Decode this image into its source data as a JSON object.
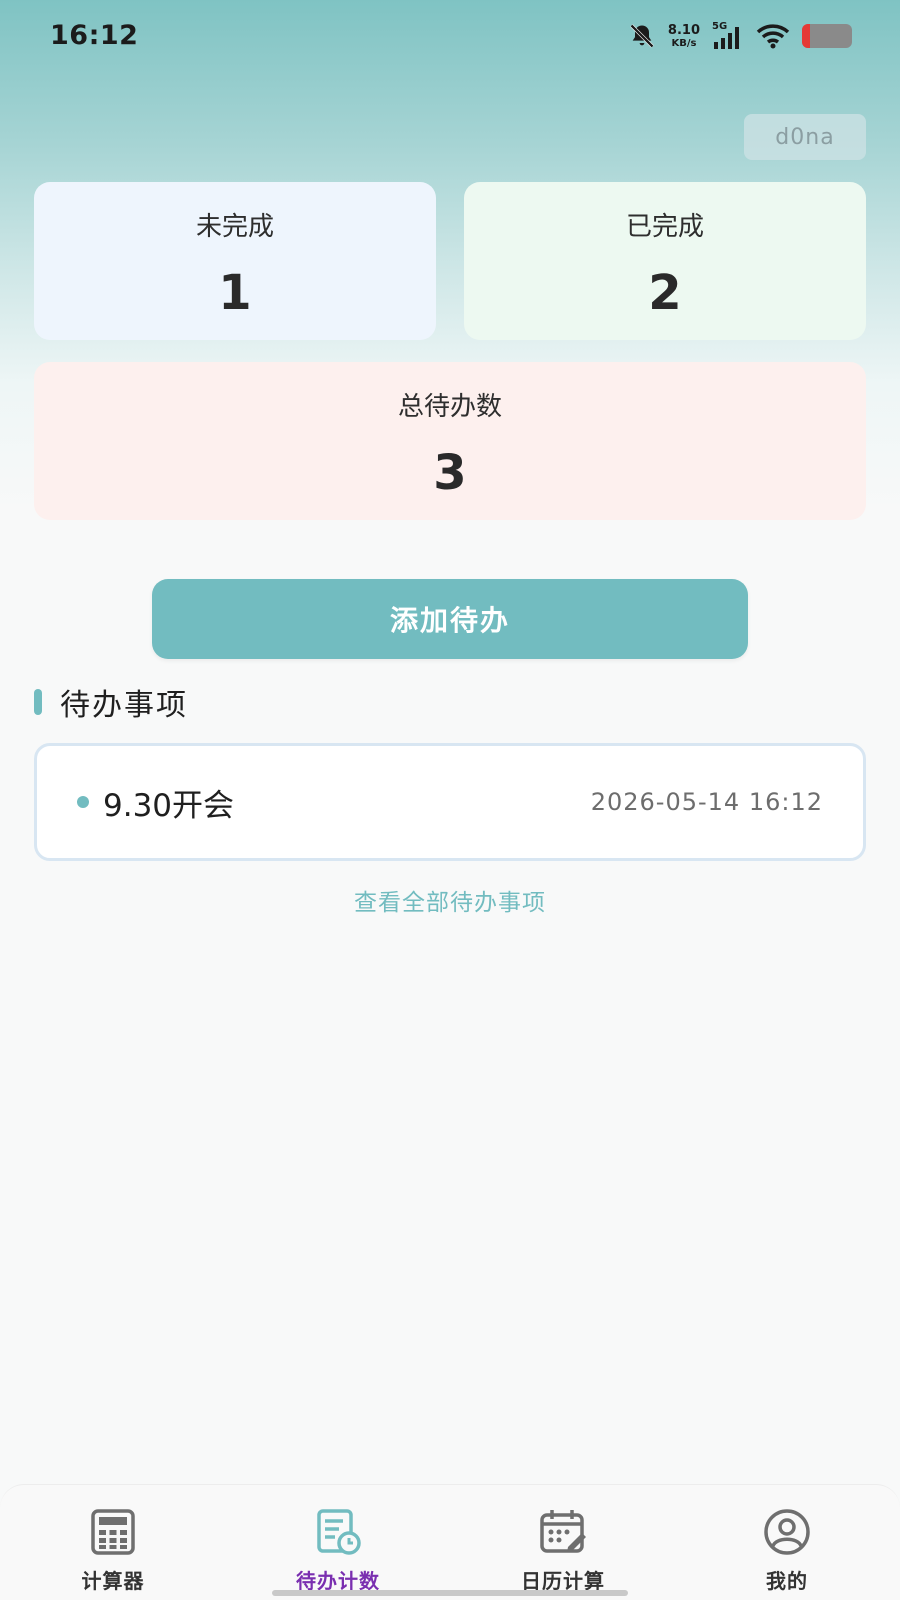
{
  "status_bar": {
    "time": "16:12",
    "net_speed_value": "8.10",
    "net_speed_unit": "KB/s",
    "network_type": "5G",
    "battery_level_fraction": 0.15,
    "icons": [
      "bell-muted-icon",
      "signal-icon",
      "wifi-icon",
      "battery-icon"
    ]
  },
  "user": {
    "name": "d0na"
  },
  "stats": {
    "incomplete": {
      "label": "未完成",
      "value": "1"
    },
    "completed": {
      "label": "已完成",
      "value": "2"
    },
    "total": {
      "label": "总待办数",
      "value": "3"
    }
  },
  "actions": {
    "add_todo_label": "添加待办"
  },
  "todo_section": {
    "title": "待办事项",
    "items": [
      {
        "title": "9.30开会",
        "time": "2026-05-14 16:12"
      }
    ],
    "view_all_label": "查看全部待办事项"
  },
  "bottom_nav": {
    "items": [
      {
        "label": "计算器",
        "icon": "calculator-icon"
      },
      {
        "label": "待办计数",
        "icon": "todo-list-icon"
      },
      {
        "label": "日历计算",
        "icon": "calendar-icon"
      },
      {
        "label": "我的",
        "icon": "user-profile-icon"
      }
    ],
    "active_index": 1
  },
  "colors": {
    "accent": "#72bcc0",
    "active_tab": "#7a2fb0",
    "card_incomplete": "#eef5fd",
    "card_completed": "#edf9f1",
    "card_total": "#fdf0ee"
  }
}
